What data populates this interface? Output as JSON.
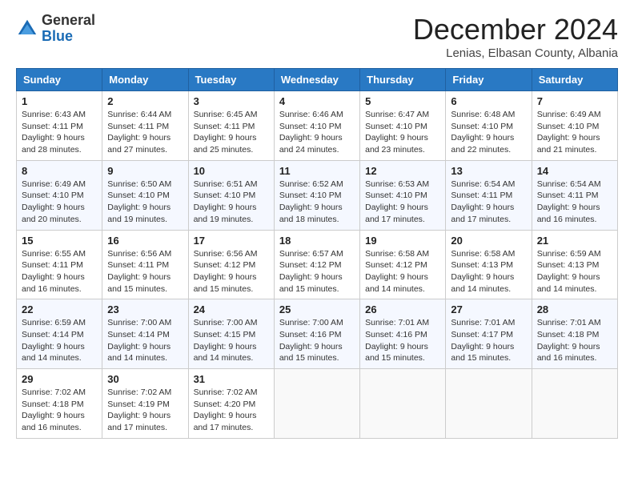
{
  "logo": {
    "general": "General",
    "blue": "Blue"
  },
  "title": "December 2024",
  "location": "Lenias, Elbasan County, Albania",
  "days_of_week": [
    "Sunday",
    "Monday",
    "Tuesday",
    "Wednesday",
    "Thursday",
    "Friday",
    "Saturday"
  ],
  "weeks": [
    [
      {
        "day": "1",
        "info": "Sunrise: 6:43 AM\nSunset: 4:11 PM\nDaylight: 9 hours\nand 28 minutes."
      },
      {
        "day": "2",
        "info": "Sunrise: 6:44 AM\nSunset: 4:11 PM\nDaylight: 9 hours\nand 27 minutes."
      },
      {
        "day": "3",
        "info": "Sunrise: 6:45 AM\nSunset: 4:11 PM\nDaylight: 9 hours\nand 25 minutes."
      },
      {
        "day": "4",
        "info": "Sunrise: 6:46 AM\nSunset: 4:10 PM\nDaylight: 9 hours\nand 24 minutes."
      },
      {
        "day": "5",
        "info": "Sunrise: 6:47 AM\nSunset: 4:10 PM\nDaylight: 9 hours\nand 23 minutes."
      },
      {
        "day": "6",
        "info": "Sunrise: 6:48 AM\nSunset: 4:10 PM\nDaylight: 9 hours\nand 22 minutes."
      },
      {
        "day": "7",
        "info": "Sunrise: 6:49 AM\nSunset: 4:10 PM\nDaylight: 9 hours\nand 21 minutes."
      }
    ],
    [
      {
        "day": "8",
        "info": "Sunrise: 6:49 AM\nSunset: 4:10 PM\nDaylight: 9 hours\nand 20 minutes."
      },
      {
        "day": "9",
        "info": "Sunrise: 6:50 AM\nSunset: 4:10 PM\nDaylight: 9 hours\nand 19 minutes."
      },
      {
        "day": "10",
        "info": "Sunrise: 6:51 AM\nSunset: 4:10 PM\nDaylight: 9 hours\nand 19 minutes."
      },
      {
        "day": "11",
        "info": "Sunrise: 6:52 AM\nSunset: 4:10 PM\nDaylight: 9 hours\nand 18 minutes."
      },
      {
        "day": "12",
        "info": "Sunrise: 6:53 AM\nSunset: 4:10 PM\nDaylight: 9 hours\nand 17 minutes."
      },
      {
        "day": "13",
        "info": "Sunrise: 6:54 AM\nSunset: 4:11 PM\nDaylight: 9 hours\nand 17 minutes."
      },
      {
        "day": "14",
        "info": "Sunrise: 6:54 AM\nSunset: 4:11 PM\nDaylight: 9 hours\nand 16 minutes."
      }
    ],
    [
      {
        "day": "15",
        "info": "Sunrise: 6:55 AM\nSunset: 4:11 PM\nDaylight: 9 hours\nand 16 minutes."
      },
      {
        "day": "16",
        "info": "Sunrise: 6:56 AM\nSunset: 4:11 PM\nDaylight: 9 hours\nand 15 minutes."
      },
      {
        "day": "17",
        "info": "Sunrise: 6:56 AM\nSunset: 4:12 PM\nDaylight: 9 hours\nand 15 minutes."
      },
      {
        "day": "18",
        "info": "Sunrise: 6:57 AM\nSunset: 4:12 PM\nDaylight: 9 hours\nand 15 minutes."
      },
      {
        "day": "19",
        "info": "Sunrise: 6:58 AM\nSunset: 4:12 PM\nDaylight: 9 hours\nand 14 minutes."
      },
      {
        "day": "20",
        "info": "Sunrise: 6:58 AM\nSunset: 4:13 PM\nDaylight: 9 hours\nand 14 minutes."
      },
      {
        "day": "21",
        "info": "Sunrise: 6:59 AM\nSunset: 4:13 PM\nDaylight: 9 hours\nand 14 minutes."
      }
    ],
    [
      {
        "day": "22",
        "info": "Sunrise: 6:59 AM\nSunset: 4:14 PM\nDaylight: 9 hours\nand 14 minutes."
      },
      {
        "day": "23",
        "info": "Sunrise: 7:00 AM\nSunset: 4:14 PM\nDaylight: 9 hours\nand 14 minutes."
      },
      {
        "day": "24",
        "info": "Sunrise: 7:00 AM\nSunset: 4:15 PM\nDaylight: 9 hours\nand 14 minutes."
      },
      {
        "day": "25",
        "info": "Sunrise: 7:00 AM\nSunset: 4:16 PM\nDaylight: 9 hours\nand 15 minutes."
      },
      {
        "day": "26",
        "info": "Sunrise: 7:01 AM\nSunset: 4:16 PM\nDaylight: 9 hours\nand 15 minutes."
      },
      {
        "day": "27",
        "info": "Sunrise: 7:01 AM\nSunset: 4:17 PM\nDaylight: 9 hours\nand 15 minutes."
      },
      {
        "day": "28",
        "info": "Sunrise: 7:01 AM\nSunset: 4:18 PM\nDaylight: 9 hours\nand 16 minutes."
      }
    ],
    [
      {
        "day": "29",
        "info": "Sunrise: 7:02 AM\nSunset: 4:18 PM\nDaylight: 9 hours\nand 16 minutes."
      },
      {
        "day": "30",
        "info": "Sunrise: 7:02 AM\nSunset: 4:19 PM\nDaylight: 9 hours\nand 17 minutes."
      },
      {
        "day": "31",
        "info": "Sunrise: 7:02 AM\nSunset: 4:20 PM\nDaylight: 9 hours\nand 17 minutes."
      },
      null,
      null,
      null,
      null
    ]
  ]
}
